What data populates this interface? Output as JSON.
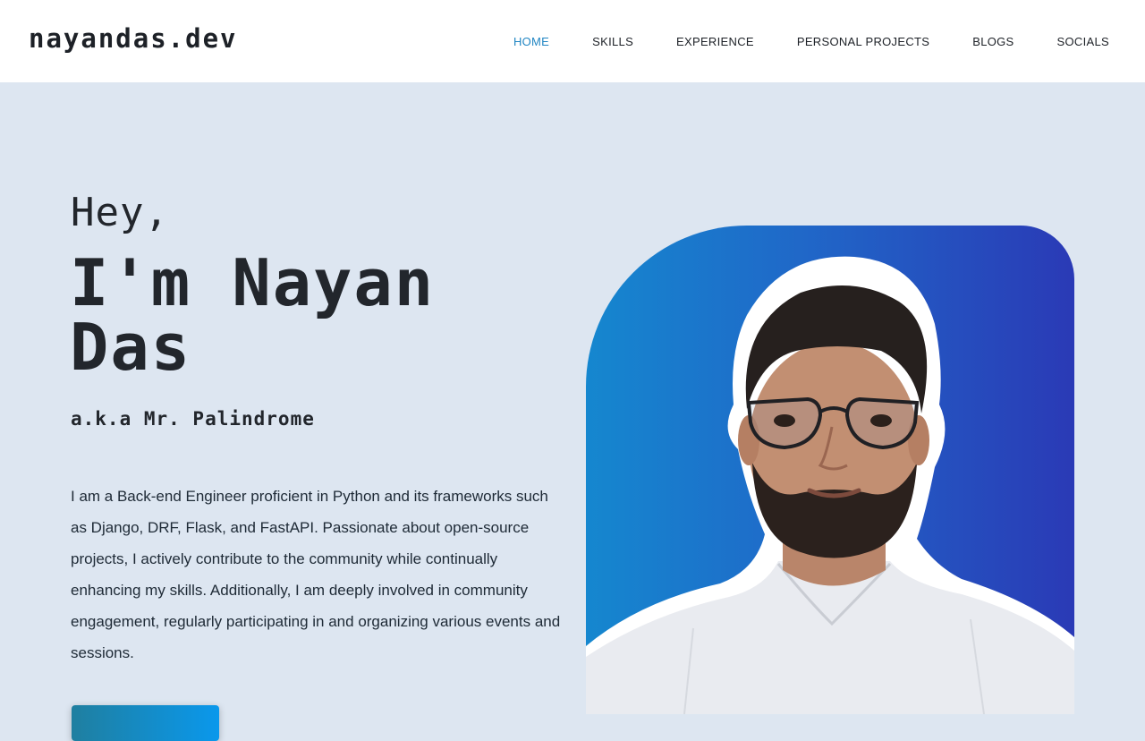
{
  "site": {
    "logo": "nayandas.dev"
  },
  "nav": {
    "items": [
      {
        "label": "HOME",
        "active": true
      },
      {
        "label": "SKILLS",
        "active": false
      },
      {
        "label": "EXPERIENCE",
        "active": false
      },
      {
        "label": "PERSONAL PROJECTS",
        "active": false
      },
      {
        "label": "BLOGS",
        "active": false
      },
      {
        "label": "SOCIALS",
        "active": false
      }
    ]
  },
  "hero": {
    "greeting": "Hey,",
    "name": "I'm Nayan Das",
    "aka": "a.k.a Mr. Palindrome",
    "bio": "I am a Back-end Engineer proficient in Python and its frameworks such as Django, DRF, Flask, and FastAPI. Passionate about open-source projects, I actively contribute to the community while continually enhancing my skills. Additionally, I am deeply involved in community engagement, regularly participating in and organizing various events and sessions."
  },
  "colors": {
    "accent": "#2286c3",
    "background": "#dde6f1",
    "header": "#ffffff",
    "card_gradient_start": "#1587cf",
    "card_gradient_end": "#2a3ab6"
  }
}
